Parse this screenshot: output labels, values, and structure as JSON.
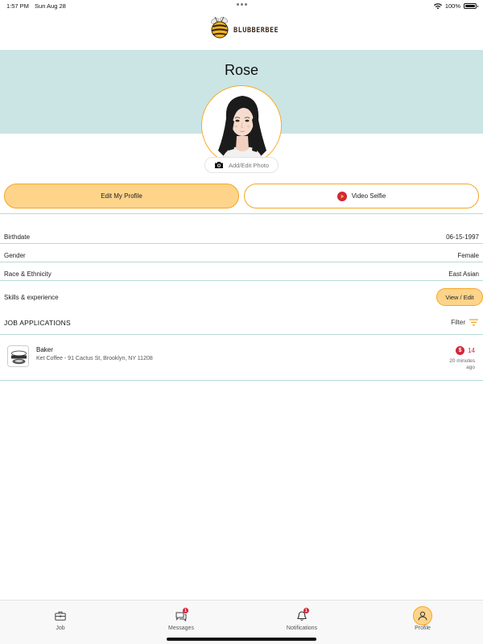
{
  "status_bar": {
    "time": "1:57 PM",
    "date": "Sun Aug 28",
    "battery": "100%",
    "battery_level": 1.0
  },
  "app": {
    "logo_text": "BLUBBERBEE"
  },
  "profile": {
    "name": "Rose",
    "add_photo_label": "Add/Edit Photo",
    "edit_button": "Edit My Profile",
    "video_button": "Video Selfie",
    "fields": [
      {
        "label": "Birthdate",
        "value": "06-15-1997"
      },
      {
        "label": "Gender",
        "value": "Female"
      },
      {
        "label": "Race & Ethnicity",
        "value": "East Asian"
      }
    ],
    "skills_label": "Skills & experience",
    "skills_button": "View / Edit"
  },
  "applications": {
    "title": "JOB APPLICATIONS",
    "filter_label": "Filter",
    "items": [
      {
        "title": "Baker",
        "subtitle": "Ket Coffee - 91 Cactus St, Brooklyn, NY 11208",
        "pay": "14",
        "time": "20 minutes ago"
      }
    ]
  },
  "tabs": [
    {
      "label": "Job",
      "icon": "briefcase-icon"
    },
    {
      "label": "Messages",
      "icon": "messages-icon",
      "badge": "1"
    },
    {
      "label": "Notifications",
      "icon": "bell-icon",
      "badge": "1"
    },
    {
      "label": "Profile",
      "icon": "profile-icon",
      "active": true
    }
  ],
  "colors": {
    "accent": "#f5a623",
    "accent_fill": "#fdd48a",
    "banner": "#cbe5e4",
    "divider": "#b7dbd6",
    "alert": "#d0273a"
  }
}
